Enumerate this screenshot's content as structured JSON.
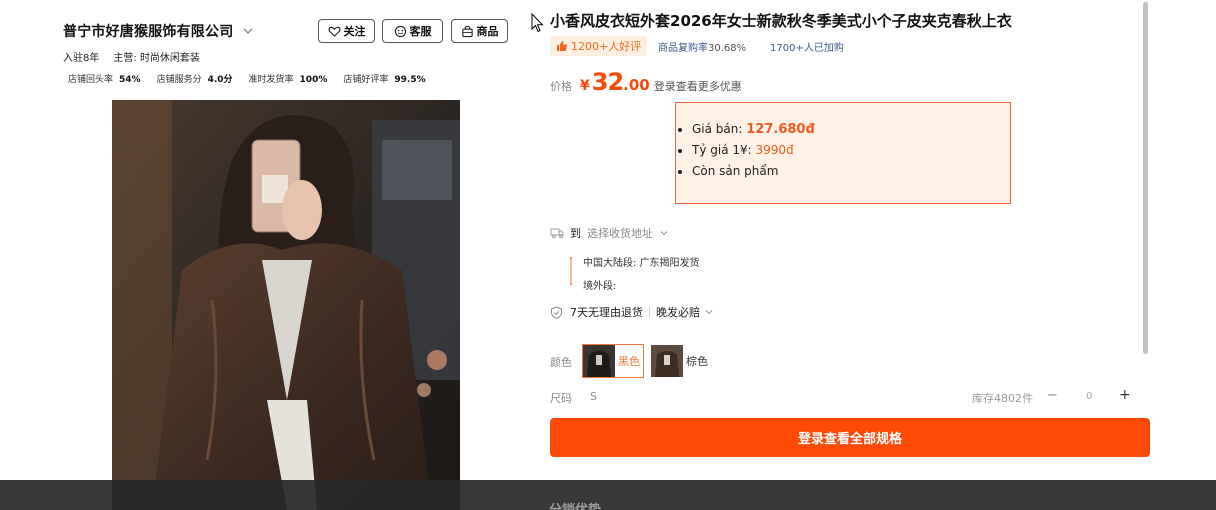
{
  "shop": {
    "name": "普宁市好唐猴服饰有限公司",
    "buttons": {
      "follow": "关注",
      "service": "客服",
      "products": "商品"
    },
    "meta": {
      "years": "入驻8年",
      "main_label": "主营:",
      "main_value": "时尚休闲套装"
    },
    "stats": [
      {
        "label": "店铺回头率",
        "value": "54%"
      },
      {
        "label": "店铺服务分",
        "value": "4.0分"
      },
      {
        "label": "准时发货率",
        "value": "100%"
      },
      {
        "label": "店铺好评率",
        "value": "99.5%"
      }
    ]
  },
  "product": {
    "title": "小香风皮衣短外套2026年女士新款秋冬季美式小个子皮夹克春秋上衣",
    "praise": "1200+人好评",
    "repurchase_label": "商品复购率",
    "repurchase_value": "30.68%",
    "cart_count": "1700+人已加购",
    "price": {
      "label": "价格",
      "symbol": "¥",
      "integer": "32",
      "decimal": ".00",
      "login_note": "登录查看更多优惠"
    },
    "vn_info": {
      "sale_label": "Giá bán:",
      "sale_value": "127.680đ",
      "rate_label": "Tỷ giá 1¥:",
      "rate_value": "3990đ",
      "stock_text": "Còn sản phẩm"
    },
    "shipping": {
      "to": "到",
      "address_placeholder": "选择收货地址",
      "segment1_label": "中国大陆段:",
      "segment1_value": "广东揭阳发货",
      "segment2_label": "境外段:"
    },
    "services": {
      "return": "7天无理由退货",
      "late": "晚发必赔"
    },
    "color": {
      "label": "颜色",
      "options": [
        "黑色",
        "棕色"
      ],
      "selected": "黑色"
    },
    "size": {
      "label": "尺码",
      "value": "S"
    },
    "stock": "库存4802件",
    "quantity": {
      "minus": "−",
      "value": "0",
      "plus": "+"
    },
    "cta": "登录查看全部规格",
    "section_below": "分销优势"
  },
  "colors": {
    "accent": "#fe4a05",
    "price": "#f44b0a",
    "link": "#3b5a8c"
  }
}
